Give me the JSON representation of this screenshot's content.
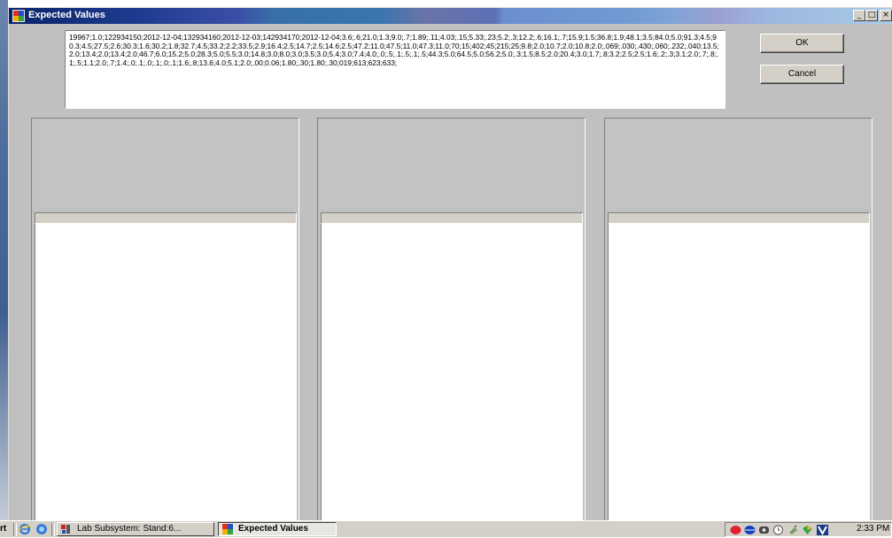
{
  "window": {
    "title": "Expected Values",
    "controls": {
      "minimize": "_",
      "maximize": "□",
      "close": "×"
    }
  },
  "expected_values_text": "19967;1.0;122934150;2012-12-04;132934160;2012-12-03;142934170;2012-12-04;3.6;.6;21.0;1.3;9.0;.7;1.89;.11;4.03;.15;5.33;.23;5.2;.3;12.2;.6;16.1;.7;15.9;1.5;36.8;1.9;48.1;3.5;84.0;5.0;91.3;4.5;90.3;4.5;27.5;2.6;30.3;1.6;30.2;1.8;32.7;4.5;33.2;2.2;33.5;2.9;16.4;2.5;14.7;2.5;14.6;2.5;47.2;11.0;47.5;11.0;47.3;11.0;70;15;402;45;215;25;9.8;2.0;10.7;2.0;10.8;2.0;.069;.030;.430;.060;.232;.040;13.5;2.0;13.4;2.0;13.4;2.0;46.7;6.0;15.2;5.0;28.3;5.0;5.5;3.0;14.8;3.0;8.0;3.0;3.5;3.0;5.4;3.0;7.4;4.0;.0;.5;.1;.5;.1;.5;44.3;5.0;64.5;5.0;56.2;5.0;.3;1.5;8.5;2.0;20.4;3.0;1.7;.8;3.2;2.5;2.5;1.6;.2;.3;3.1;2.0;.7;.8;.1;.5;1.1;2.0;.7;1.4;.0;.1;.0;.1;.0;.1;1.6;.8;13.6;4.0;5.1;2.0;.00;0.06;1.80;.30;1.80;.30;019;613;623;633;",
  "buttons": {
    "ok": "OK",
    "cancel": "Cancel"
  },
  "taskbar": {
    "start_fragment": "rt",
    "tasks": [
      {
        "label": "Lab Subsystem: Stand:6...",
        "active": false
      },
      {
        "label": "Expected Values",
        "active": true
      }
    ],
    "clock": "2:33 PM"
  },
  "colors": {
    "window_bg": "#c0c0c0",
    "titlebar_start": "#0a246a",
    "titlebar_end": "#a8cbe8",
    "button_face": "#d4d0c8"
  }
}
